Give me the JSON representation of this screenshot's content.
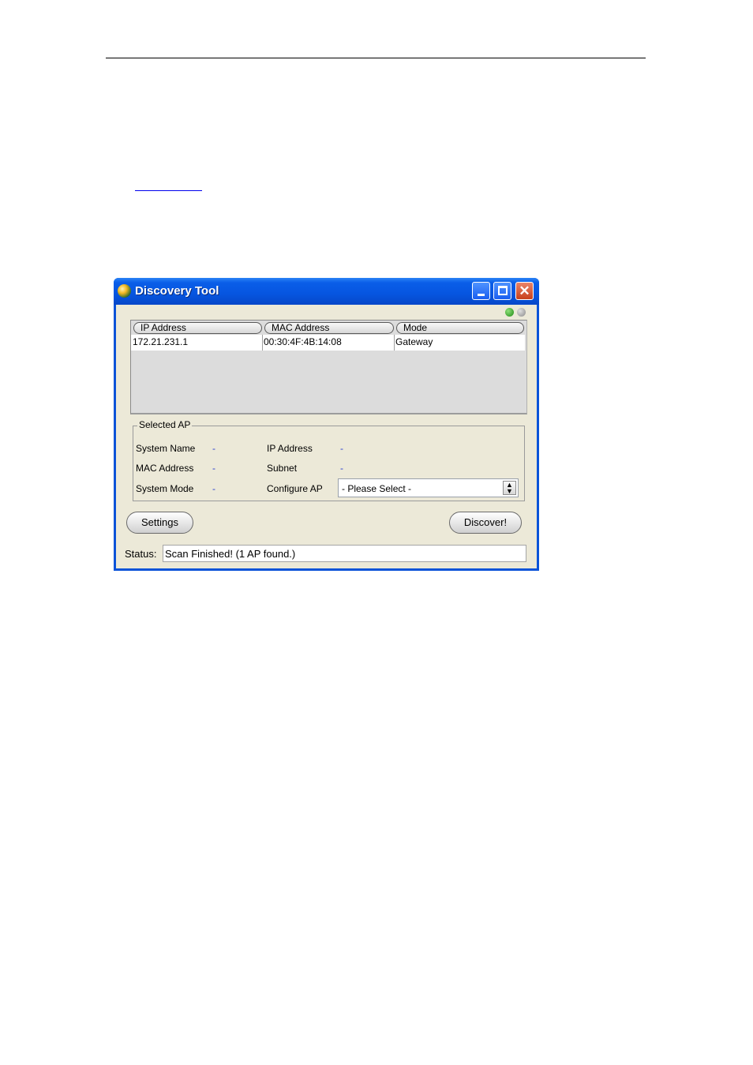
{
  "window": {
    "title": "Discovery Tool"
  },
  "list": {
    "columns": [
      "IP Address",
      "MAC Address",
      "Mode"
    ],
    "rows": [
      [
        "172.21.231.1",
        "00:30:4F:4B:14:08",
        "Gateway"
      ]
    ]
  },
  "selected_ap": {
    "legend": "Selected AP",
    "system_name_label": "System Name",
    "system_name_value": "-",
    "mac_address_label": "MAC Address",
    "mac_address_value": "-",
    "system_mode_label": "System Mode",
    "system_mode_value": "-",
    "ip_address_label": "IP Address",
    "ip_address_value": "-",
    "subnet_label": "Subnet",
    "subnet_value": "-",
    "configure_label": "Configure AP",
    "configure_selected": "- Please Select -"
  },
  "buttons": {
    "settings": "Settings",
    "discover": "Discover!"
  },
  "status": {
    "label": "Status:",
    "text": "Scan Finished! (1 AP found.)"
  },
  "icons": {
    "app": "discovery-globe-icon",
    "minimize": "minimize-icon",
    "maximize": "maximize-icon",
    "close": "close-icon",
    "spinner": "spinner-arrows-icon",
    "status_green": "status-led-green-icon",
    "status_gray": "status-led-gray-icon"
  },
  "colors": {
    "titlebar": "#0655e0",
    "client_bg": "#ece9d8",
    "value_text": "#2a3fcf",
    "close_button": "#c8401b"
  }
}
